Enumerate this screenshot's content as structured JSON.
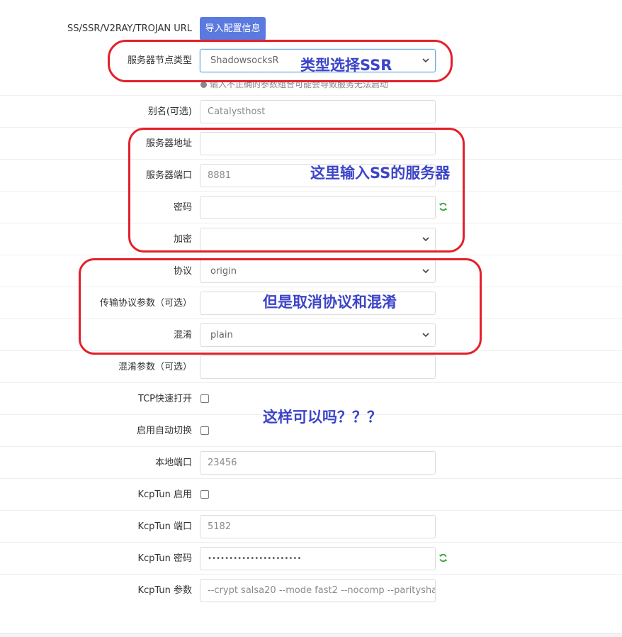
{
  "import": {
    "label": "SS/SSR/V2RAY/TROJAN URL",
    "button": "导入配置信息"
  },
  "fields": {
    "node_type": {
      "label": "服务器节点类型",
      "value": "ShadowsocksR"
    },
    "hint": "输入不正确的参数组合可能会导致服务无法启动",
    "alias": {
      "label": "别名(可选)",
      "placeholder": "Catalysthost"
    },
    "server": {
      "label": "服务器地址",
      "value": ""
    },
    "port": {
      "label": "服务器端口",
      "placeholder": "8881"
    },
    "password": {
      "label": "密码",
      "value": ""
    },
    "encrypt": {
      "label": "加密",
      "value": ""
    },
    "protocol": {
      "label": "协议",
      "value": "origin"
    },
    "protocol_param": {
      "label": "传输协议参数（可选）",
      "value": ""
    },
    "obfs": {
      "label": "混淆",
      "value": "plain"
    },
    "obfs_param": {
      "label": "混淆参数（可选）",
      "value": ""
    },
    "tcp_fast_open": {
      "label": "TCP快速打开"
    },
    "auto_switch": {
      "label": "启用自动切换"
    },
    "local_port": {
      "label": "本地端口",
      "placeholder": "23456"
    },
    "kcptun_enable": {
      "label": "KcpTun 启用"
    },
    "kcptun_port": {
      "label": "KcpTun 端口",
      "placeholder": "5182"
    },
    "kcptun_password": {
      "label": "KcpTun 密码",
      "value": "••••••••••••••••••••••"
    },
    "kcptun_param": {
      "label": "KcpTun 参数",
      "placeholder": "--crypt salsa20 --mode fast2 --nocomp --paritysha"
    }
  },
  "annotations": {
    "type_note": "类型选择SSR",
    "server_note": "这里输入SS的服务器",
    "protocol_note": "但是取消协议和混淆",
    "question": "这样可以吗？？？"
  },
  "colors": {
    "accent_button": "#5b7ae0",
    "annotation_red": "#e3202a",
    "annotation_blue": "#3c44c8",
    "refresh_green": "#3aa53a"
  },
  "icons": {
    "select_arrow": "chevron-down-icon",
    "regenerate": "refresh-icon",
    "info": "info-icon"
  }
}
